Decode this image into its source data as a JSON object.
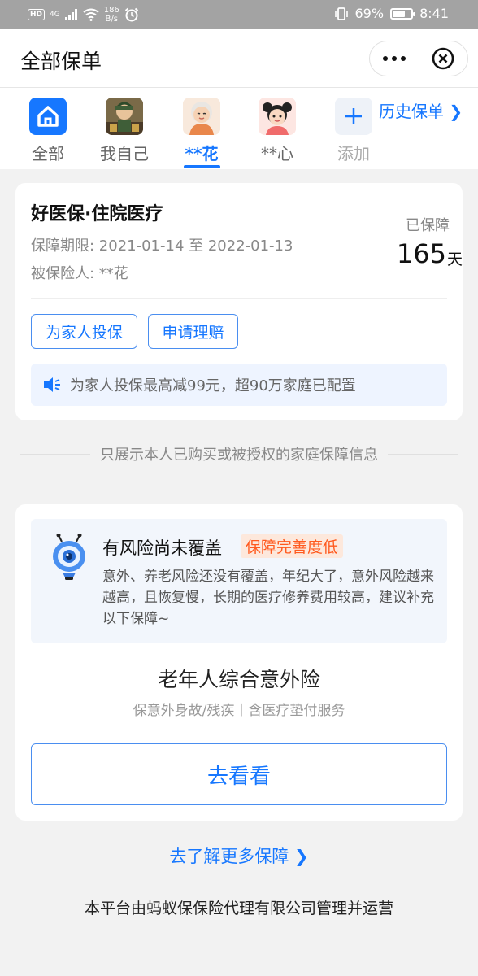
{
  "status_bar": {
    "hd": "HD",
    "signal": "4G",
    "speed_top": "186",
    "speed_bottom": "B/s",
    "battery": "69%",
    "battery_level": 0.69,
    "time": "8:41"
  },
  "header": {
    "title": "全部保单"
  },
  "tabs": [
    {
      "label": "全部",
      "icon": "home-icon"
    },
    {
      "label": "我自己",
      "icon": "avatar-cartoon-man"
    },
    {
      "label": "**花",
      "icon": "avatar-grandmother",
      "active": true
    },
    {
      "label": "**心",
      "icon": "avatar-girl"
    },
    {
      "label": "添加",
      "icon": "plus-icon"
    }
  ],
  "history_link": "历史保单 ❯",
  "policy": {
    "name": "好医保·住院医疗",
    "period": "保障期限: 2021-01-14 至 2022-01-13",
    "insured": "被保险人: **花",
    "covered_label": "已保障",
    "covered_days": "165",
    "covered_unit": "天",
    "btn_insure_family": "为家人投保",
    "btn_claim": "申请理赔",
    "promo": "为家人投保最高减99元，超90万家庭已配置"
  },
  "notice": "只展示本人已购买或被授权的家庭保障信息",
  "risk": {
    "title": "有风险尚未覆盖",
    "tag": "保障完善度低",
    "desc": "意外、养老风险还没有覆盖，年纪大了，意外风险越来越高，且恢复慢，长期的医疗修养费用较高，建议补充以下保障~",
    "product_name": "老年人综合意外险",
    "product_sub": "保意外身故/残疾丨含医疗垫付服务",
    "go_button": "去看看"
  },
  "more_link": "去了解更多保障 ❯",
  "footer": "本平台由蚂蚁保保险代理有限公司管理并运营",
  "colors": {
    "accent": "#1677ff",
    "warn": "#ff5a1f",
    "status_bar": "#a3a3a3"
  }
}
